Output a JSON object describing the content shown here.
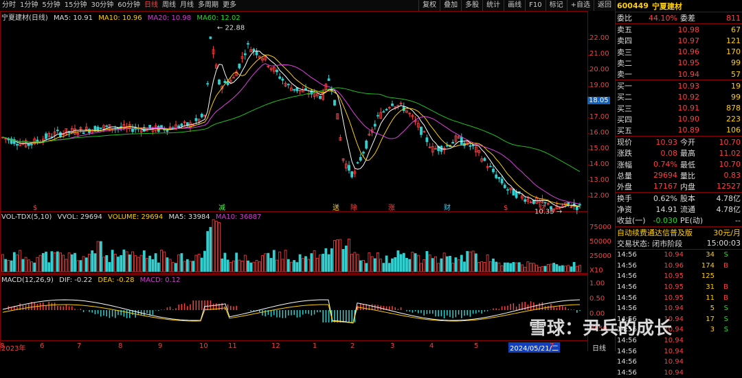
{
  "periods": [
    "分时",
    "1分钟",
    "5分钟",
    "15分钟",
    "30分钟",
    "60分钟",
    "日线",
    "周线",
    "月线",
    "多周期",
    "更多"
  ],
  "active_period": "日线",
  "tools": [
    "复权",
    "叠加",
    "多股",
    "统计",
    "画线",
    "F10",
    "标记",
    "+自选",
    "返回"
  ],
  "header": {
    "stock_title": "宁夏建材(日线)",
    "ma5": "MA5: 10.91",
    "ma10": "MA10: 10.96",
    "ma20": "MA20: 10.98",
    "ma60": "MA60: 12.02"
  },
  "price_axis": [
    "22.00",
    "21.00",
    "20.00",
    "19.00",
    "18.00",
    "17.00",
    "16.00",
    "15.00",
    "14.00",
    "13.00",
    "12.00"
  ],
  "current_price_tag": "18.05",
  "high_label": "22.88",
  "low_label": "10.35",
  "event_marks": [
    "$",
    "减",
    "送",
    "除",
    "涨",
    "财",
    "$",
    "财"
  ],
  "vol_legend": {
    "name": "VOL-TDX(5,10)",
    "vvol": "VVOL: 29694",
    "volume": "VOLUME: 29694",
    "ma5": "MA5: 33984",
    "ma10": "MA10: 36887"
  },
  "vol_axis": [
    "75000",
    "50000",
    "25000",
    "X10"
  ],
  "macd_legend": {
    "name": "MACD(12,26,9)",
    "dif": "DIF: -0.22",
    "dea": "DEA: -0.28",
    "macd": "MACD: 0.12"
  },
  "macd_axis": [
    "1.00",
    "0.50",
    "0.00",
    "-0.50"
  ],
  "date_axis": [
    "2023年",
    "6",
    "7",
    "8",
    "9",
    "10",
    "11",
    "12",
    "1",
    "2",
    "3",
    "4",
    "5",
    "2024/05/21/二",
    "7",
    "8"
  ],
  "bottom_tab": "日线",
  "watermark": "雪球：尹兵的成长",
  "side": {
    "code": "600449",
    "name": "宁夏建材",
    "webi_label": "委比",
    "webi_value": "44.10%",
    "wecha_label": "委差",
    "wecha_value": "811",
    "asks": [
      {
        "label": "卖五",
        "price": "10.98",
        "vol": "67"
      },
      {
        "label": "卖四",
        "price": "10.97",
        "vol": "121"
      },
      {
        "label": "卖三",
        "price": "10.96",
        "vol": "170"
      },
      {
        "label": "卖二",
        "price": "10.95",
        "vol": "99"
      },
      {
        "label": "卖一",
        "price": "10.94",
        "vol": "57"
      }
    ],
    "bids": [
      {
        "label": "买一",
        "price": "10.93",
        "vol": "19"
      },
      {
        "label": "买二",
        "price": "10.92",
        "vol": "99"
      },
      {
        "label": "买三",
        "price": "10.91",
        "vol": "878"
      },
      {
        "label": "买四",
        "price": "10.90",
        "vol": "223"
      },
      {
        "label": "买五",
        "price": "10.89",
        "vol": "106"
      }
    ],
    "stats": [
      {
        "l1": "现价",
        "v1": "10.93",
        "l2": "今开",
        "v2": "10.70"
      },
      {
        "l1": "涨跌",
        "v1": "0.08",
        "l2": "最高",
        "v2": "11.02"
      },
      {
        "l1": "涨幅",
        "v1": "0.74%",
        "l2": "最低",
        "v2": "10.70"
      },
      {
        "l1": "总量",
        "v1": "29694",
        "l2": "量比",
        "v2": "0.83"
      },
      {
        "l1": "外盘",
        "v1": "17167",
        "l2": "内盘",
        "v2": "12527"
      }
    ],
    "stats2": [
      {
        "l1": "换手",
        "v1": "0.62%",
        "l2": "股本",
        "v2": "4.78亿"
      },
      {
        "l1": "净资",
        "v1": "14.91",
        "l2": "流通",
        "v2": "4.78亿"
      },
      {
        "l1": "收益(一)",
        "v1": "-0.030",
        "l2": "PE(动)",
        "v2": "--"
      }
    ],
    "promo": "自动续费通达信普及版",
    "promo_price": "30元/月",
    "status_label": "交易状态: 闭市阶段",
    "status_time": "15:00:03",
    "ticks": [
      {
        "t": "14:56",
        "p": "10.94",
        "v": "34",
        "d": "S"
      },
      {
        "t": "14:56",
        "p": "10.96",
        "v": "174",
        "d": "B"
      },
      {
        "t": "14:56",
        "p": "10.95",
        "v": "125",
        "d": ""
      },
      {
        "t": "14:56",
        "p": "10.95",
        "v": "31",
        "d": "B"
      },
      {
        "t": "14:56",
        "p": "10.95",
        "v": "11",
        "d": "B"
      },
      {
        "t": "14:56",
        "p": "10.94",
        "v": "5",
        "d": "S"
      },
      {
        "t": "14:56",
        "p": "10.94",
        "v": "17",
        "d": "S"
      },
      {
        "t": "14:56",
        "p": "10.94",
        "v": "3",
        "d": "S"
      },
      {
        "t": "14:56",
        "p": "10.94",
        "v": "",
        "d": ""
      },
      {
        "t": "14:56",
        "p": "10.94",
        "v": "",
        "d": ""
      },
      {
        "t": "14:56",
        "p": "10.94",
        "v": "",
        "d": ""
      },
      {
        "t": "14:56",
        "p": "10.94",
        "v": "",
        "d": ""
      }
    ]
  },
  "colors": {
    "up": "#ff4040",
    "down": "#30d0d0",
    "ma5": "#ffffff",
    "ma10": "#ffd000",
    "ma20": "#e040e0",
    "ma60": "#20c020"
  }
}
